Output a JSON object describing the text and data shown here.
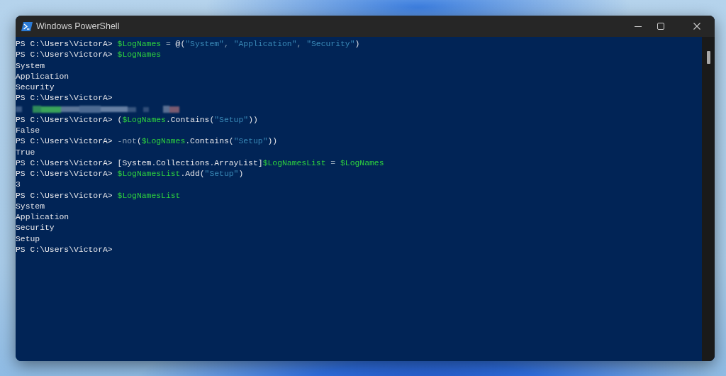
{
  "window": {
    "title": "Windows PowerShell"
  },
  "console": {
    "lines": [
      {
        "kind": "prompt",
        "prompt": "PS C:\\Users\\VictorA>",
        "tokens": [
          {
            "kind": "variable",
            "text": " $LogNames"
          },
          {
            "kind": "operator",
            "text": " = "
          },
          {
            "kind": "plain",
            "text": "@("
          },
          {
            "kind": "string",
            "text": "\"System\""
          },
          {
            "kind": "operator",
            "text": ", "
          },
          {
            "kind": "string",
            "text": "\"Application\""
          },
          {
            "kind": "operator",
            "text": ", "
          },
          {
            "kind": "string",
            "text": "\"Security\""
          },
          {
            "kind": "plain",
            "text": ")"
          }
        ]
      },
      {
        "kind": "prompt",
        "prompt": "PS C:\\Users\\VictorA>",
        "tokens": [
          {
            "kind": "variable",
            "text": " $LogNames"
          }
        ]
      },
      {
        "kind": "output",
        "text": "System"
      },
      {
        "kind": "output",
        "text": "Application"
      },
      {
        "kind": "output",
        "text": "Security"
      },
      {
        "kind": "prompt",
        "prompt": "PS C:\\Users\\VictorA>"
      },
      {
        "kind": "redacted"
      },
      {
        "kind": "prompt",
        "prompt": "PS C:\\Users\\VictorA>",
        "tokens": [
          {
            "kind": "plain",
            "text": " ("
          },
          {
            "kind": "variable",
            "text": "$LogNames"
          },
          {
            "kind": "plain",
            "text": ".Contains("
          },
          {
            "kind": "string",
            "text": "\"Setup\""
          },
          {
            "kind": "plain",
            "text": "))"
          }
        ]
      },
      {
        "kind": "output",
        "text": "False"
      },
      {
        "kind": "prompt",
        "prompt": "PS C:\\Users\\VictorA>",
        "tokens": [
          {
            "kind": "operator",
            "text": " -not"
          },
          {
            "kind": "plain",
            "text": "("
          },
          {
            "kind": "variable",
            "text": "$LogNames"
          },
          {
            "kind": "plain",
            "text": ".Contains("
          },
          {
            "kind": "string",
            "text": "\"Setup\""
          },
          {
            "kind": "plain",
            "text": "))"
          }
        ]
      },
      {
        "kind": "output",
        "text": "True"
      },
      {
        "kind": "prompt",
        "prompt": "PS C:\\Users\\VictorA>",
        "tokens": [
          {
            "kind": "plain",
            "text": " [System.Collections.ArrayList]"
          },
          {
            "kind": "variable",
            "text": "$LogNamesList"
          },
          {
            "kind": "operator",
            "text": " = "
          },
          {
            "kind": "variable",
            "text": "$LogNames"
          }
        ]
      },
      {
        "kind": "prompt",
        "prompt": "PS C:\\Users\\VictorA>",
        "tokens": [
          {
            "kind": "variable",
            "text": " $LogNamesList"
          },
          {
            "kind": "plain",
            "text": ".Add("
          },
          {
            "kind": "string",
            "text": "\"Setup\""
          },
          {
            "kind": "plain",
            "text": ")"
          }
        ]
      },
      {
        "kind": "output",
        "text": "3"
      },
      {
        "kind": "prompt",
        "prompt": "PS C:\\Users\\VictorA>",
        "tokens": [
          {
            "kind": "variable",
            "text": " $LogNamesList"
          }
        ]
      },
      {
        "kind": "output",
        "text": "System"
      },
      {
        "kind": "output",
        "text": "Application"
      },
      {
        "kind": "output",
        "text": "Security"
      },
      {
        "kind": "output",
        "text": "Setup"
      },
      {
        "kind": "prompt",
        "prompt": "PS C:\\Users\\VictorA>"
      }
    ]
  }
}
